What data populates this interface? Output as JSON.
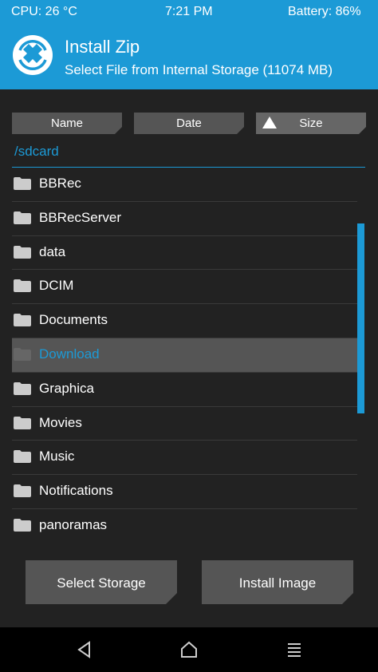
{
  "status": {
    "cpu": "CPU: 26 °C",
    "time": "7:21 PM",
    "battery": "Battery: 86%"
  },
  "header": {
    "title": "Install Zip",
    "subtitle": "Select File from Internal Storage (11074 MB)",
    "logo_icon": "twrp-logo-icon"
  },
  "sort": {
    "name_label": "Name",
    "date_label": "Date",
    "size_label": "Size",
    "active": "size"
  },
  "path": "/sdcard",
  "files": [
    {
      "name": "BBRec"
    },
    {
      "name": "BBRecServer"
    },
    {
      "name": "data"
    },
    {
      "name": "DCIM"
    },
    {
      "name": "Documents"
    },
    {
      "name": "Download",
      "selected": true
    },
    {
      "name": "Graphica"
    },
    {
      "name": "Movies"
    },
    {
      "name": "Music"
    },
    {
      "name": "Notifications"
    },
    {
      "name": "panoramas"
    }
  ],
  "buttons": {
    "select_storage": "Select Storage",
    "install_image": "Install Image"
  },
  "colors": {
    "accent": "#1c9ad6",
    "panel": "#222222",
    "button": "#555555"
  }
}
